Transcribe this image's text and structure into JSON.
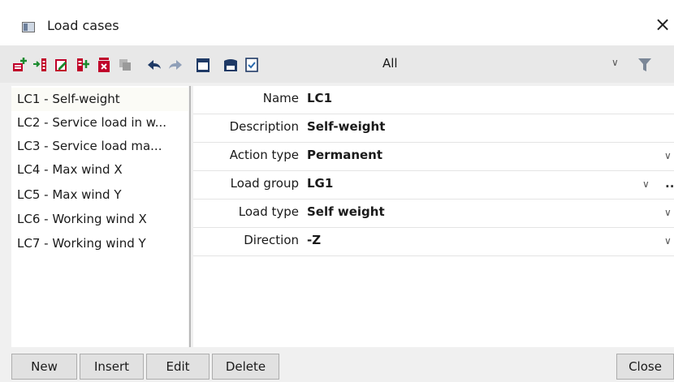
{
  "window": {
    "title": "Load cases",
    "close_glyph": "×"
  },
  "toolbar": {
    "icons": [
      {
        "name": "new-load-case-icon",
        "color": "#c0002a"
      },
      {
        "name": "insert-load-case-icon",
        "color": "#c0002a"
      },
      {
        "name": "edit-load-case-icon",
        "color": "#c0002a"
      },
      {
        "name": "copy-load-case-icon",
        "color": "#c0002a"
      },
      {
        "name": "delete-load-case-icon",
        "color": "#c0002a"
      },
      {
        "name": "duplicate-icon",
        "color": "#9a9a9a"
      },
      {
        "name": "undo-icon",
        "color": "#1f3a66"
      },
      {
        "name": "redo-icon",
        "color": "#8f9fb8"
      },
      {
        "name": "table-view-icon",
        "color": "#1f3a66"
      },
      {
        "name": "save-icon",
        "color": "#1f3a66"
      },
      {
        "name": "check-list-icon",
        "color": "#1f3a66"
      }
    ],
    "filter_value": "All",
    "filter_chevron": "∨",
    "filter_icon": "funnel-icon"
  },
  "load_cases": [
    {
      "label": "LC1 - Self-weight",
      "selected": true
    },
    {
      "label": "LC2 - Service load in w..."
    },
    {
      "label": "LC3 - Service load ma..."
    },
    {
      "label": "LC4 - Max wind X"
    },
    {
      "label": "LC5 - Max wind Y"
    },
    {
      "label": "LC6 - Working wind X"
    },
    {
      "label": "LC7 - Working wind Y"
    }
  ],
  "properties": {
    "name": {
      "label": "Name",
      "value": "LC1"
    },
    "description": {
      "label": "Description",
      "value": "Self-weight"
    },
    "action_type": {
      "label": "Action type",
      "value": "Permanent",
      "chevron": "∨"
    },
    "load_group": {
      "label": "Load group",
      "value": "LG1",
      "chevron": "∨",
      "more": ".."
    },
    "load_type": {
      "label": "Load type",
      "value": "Self weight",
      "chevron": "∨"
    },
    "direction": {
      "label": "Direction",
      "value": "-Z",
      "chevron": "∨"
    }
  },
  "buttons": {
    "new": "New",
    "insert": "Insert",
    "edit": "Edit",
    "delete": "Delete",
    "close": "Close"
  }
}
